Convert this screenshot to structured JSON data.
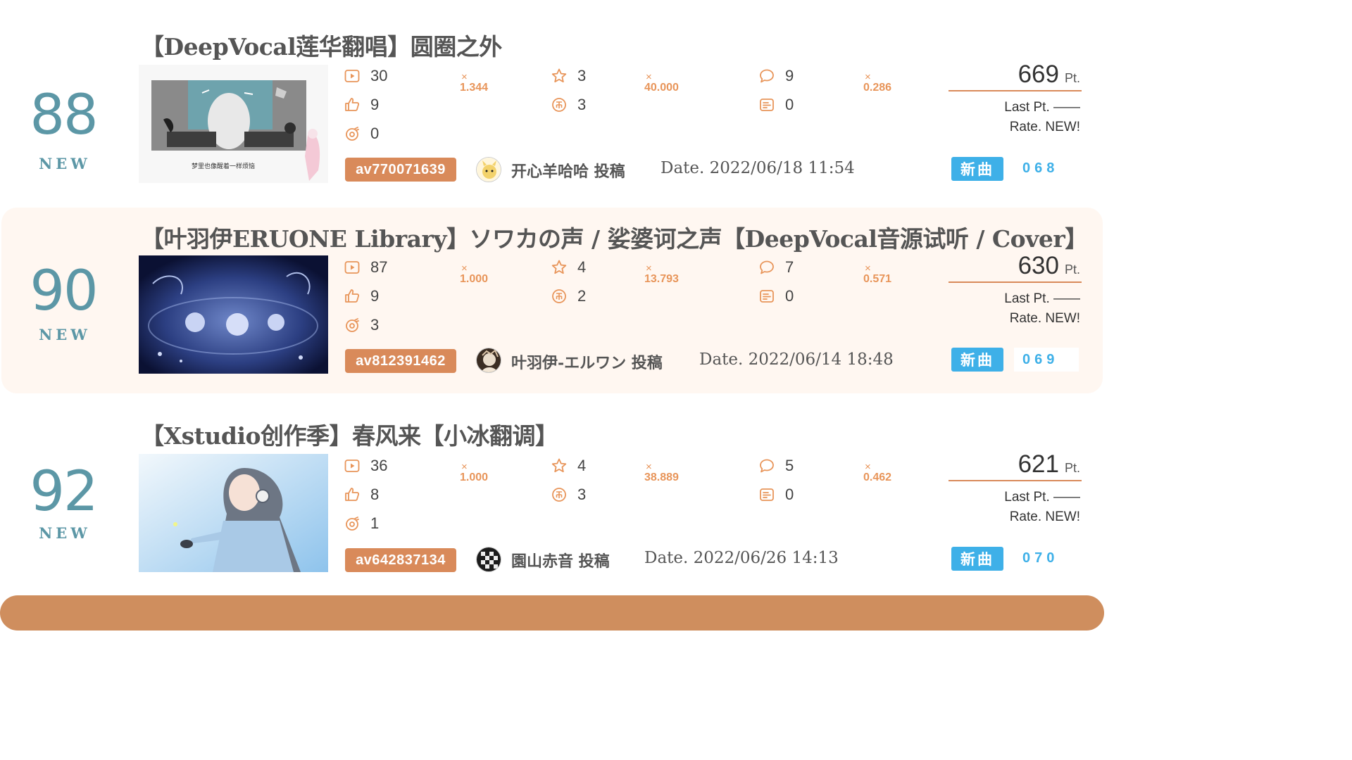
{
  "colors": {
    "rank": "#5c97a6",
    "accent": "#d98a5a",
    "badge": "#3eb0e8",
    "alt_background": "#fff7f1",
    "footer": "#cf8e5e"
  },
  "icons": [
    "play-icon",
    "like-icon",
    "coin-icon",
    "star-icon",
    "share-icon",
    "comment-icon",
    "danmaku-icon"
  ],
  "entries": [
    {
      "rank": "88",
      "rank_note": "NEW",
      "title": "【DeepVocal莲华翻唱】圆圈之外",
      "cover_caption": "梦里也像醒着一样烦恼",
      "stats": {
        "play": "30",
        "like": "9",
        "coin": "0",
        "favorite": "3",
        "share": "3",
        "comment": "9",
        "danmaku": "0"
      },
      "multipliers": {
        "play": "1.344",
        "favorite": "40.000",
        "comment": "0.286"
      },
      "av_id": "av770071639",
      "uploader": "开心羊哈哈 投稿",
      "date": "Date. 2022/06/18 11:54",
      "points": "669",
      "points_unit": "Pt.",
      "last_pt": "Last Pt. ——",
      "rate": "Rate. NEW!",
      "badge": "新曲",
      "sequence": "068"
    },
    {
      "rank": "90",
      "rank_note": "NEW",
      "title": "【叶羽伊ERUONE Library】ソワカの声 / 娑婆诃之声【DeepVocal音源试听 / Cover】",
      "stats": {
        "play": "87",
        "like": "9",
        "coin": "3",
        "favorite": "4",
        "share": "2",
        "comment": "7",
        "danmaku": "0"
      },
      "multipliers": {
        "play": "1.000",
        "favorite": "13.793",
        "comment": "0.571"
      },
      "av_id": "av812391462",
      "uploader": "叶羽伊-エルワン 投稿",
      "date": "Date. 2022/06/14 18:48",
      "points": "630",
      "points_unit": "Pt.",
      "last_pt": "Last Pt. ——",
      "rate": "Rate. NEW!",
      "badge": "新曲",
      "sequence": "069"
    },
    {
      "rank": "92",
      "rank_note": "NEW",
      "title": "【Xstudio创作季】春风来【小冰翻调】",
      "stats": {
        "play": "36",
        "like": "8",
        "coin": "1",
        "favorite": "4",
        "share": "3",
        "comment": "5",
        "danmaku": "0"
      },
      "multipliers": {
        "play": "1.000",
        "favorite": "38.889",
        "comment": "0.462"
      },
      "av_id": "av642837134",
      "uploader": "園山赤音 投稿",
      "date": "Date. 2022/06/26 14:13",
      "points": "621",
      "points_unit": "Pt.",
      "last_pt": "Last Pt. ——",
      "rate": "Rate. NEW!",
      "badge": "新曲",
      "sequence": "070"
    }
  ]
}
